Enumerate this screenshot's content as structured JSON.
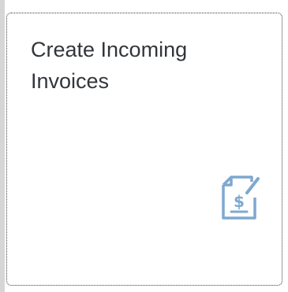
{
  "tile": {
    "title": "Create Incoming Invoices",
    "icon": "invoice-dollar-icon",
    "icon_color": "#7fa8d0",
    "text_color": "#32363a",
    "border_color": "#3a3a3a"
  }
}
